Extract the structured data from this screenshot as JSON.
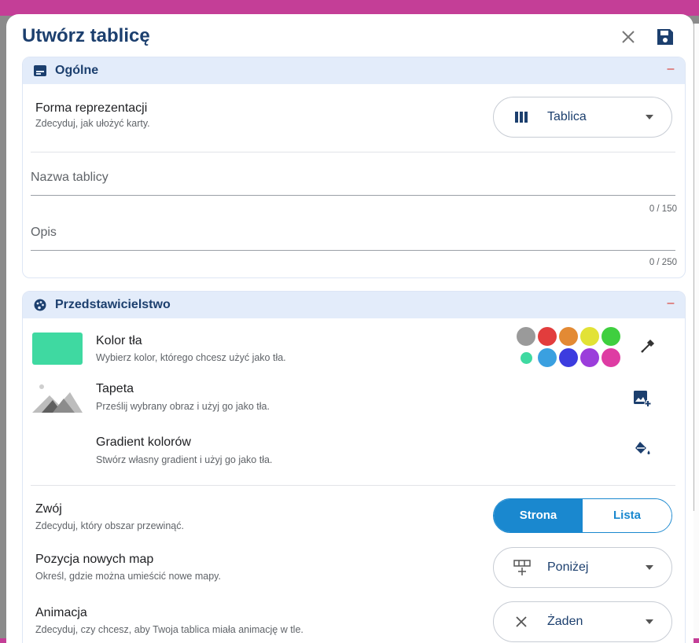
{
  "dialog": {
    "title": "Utwórz tablicę"
  },
  "general": {
    "title": "Ogólne",
    "collapse_symbol": "–",
    "representation": {
      "label": "Forma reprezentacji",
      "hint": "Zdecyduj, jak ułożyć karty.",
      "value": "Tablica"
    },
    "board_name": {
      "placeholder": "Nazwa tablicy",
      "value": "",
      "counter": "0 / 150"
    },
    "description": {
      "placeholder": "Opis",
      "value": "",
      "counter": "0 / 250"
    }
  },
  "appearance": {
    "title": "Przedstawicielstwo",
    "collapse_symbol": "–",
    "background_color": {
      "label": "Kolor tła",
      "hint": "Wybierz kolor, którego chcesz użyć jako tła.",
      "current": "#3fd9a1"
    },
    "wallpaper": {
      "label": "Tapeta",
      "hint": "Prześlij wybrany obraz i użyj go jako tła."
    },
    "gradient": {
      "label": "Gradient kolorów",
      "hint": "Stwórz własny gradient i użyj go jako tła."
    },
    "swatches_row1": [
      "#9a9a9a",
      "#e23d3d",
      "#e38a34",
      "#e2e236",
      "#3fcf3f"
    ],
    "swatches_row2": [
      "#3fd9a1",
      "#3aa0e0",
      "#3c3cdf",
      "#9b3ddb",
      "#de3ca3"
    ],
    "scroll": {
      "label": "Zwój",
      "hint": "Zdecyduj, który obszar przewinąć.",
      "options": [
        "Strona",
        "Lista"
      ],
      "selected": "Strona"
    },
    "new_maps_position": {
      "label": "Pozycja nowych map",
      "hint": "Określ, gdzie można umieścić nowe mapy.",
      "value": "Poniżej"
    },
    "animation": {
      "label": "Animacja",
      "hint": "Zdecyduj, czy chcesz, aby Twoja tablica miała animację w tle.",
      "value": "Żaden"
    }
  },
  "colors": {
    "primary": "#1a88cf",
    "title": "#1c3f6e",
    "section_header_bg": "#e3ecfa",
    "collapse": "#d93025"
  }
}
